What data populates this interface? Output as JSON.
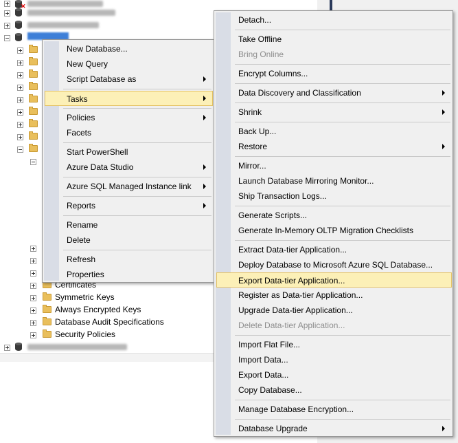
{
  "tree": {
    "visible_nodes": [
      "Certificates",
      "Symmetric Keys",
      "Always Encrypted Keys",
      "Database Audit Specifications",
      "Security Policies"
    ]
  },
  "database_menu": {
    "items": [
      "New Database...",
      "New Query",
      "Script Database as",
      "Tasks",
      "Policies",
      "Facets",
      "Start PowerShell",
      "Azure Data Studio",
      "Azure SQL Managed Instance link",
      "Reports",
      "Rename",
      "Delete",
      "Refresh",
      "Properties"
    ],
    "highlighted": "Tasks"
  },
  "tasks_menu": {
    "items": [
      "Detach...",
      "Take Offline",
      "Bring Online",
      "Encrypt Columns...",
      "Data Discovery and Classification",
      "Shrink",
      "Back Up...",
      "Restore",
      "Mirror...",
      "Launch Database Mirroring Monitor...",
      "Ship Transaction Logs...",
      "Generate Scripts...",
      "Generate In-Memory OLTP Migration Checklists",
      "Extract Data-tier Application...",
      "Deploy Database to Microsoft Azure SQL Database...",
      "Export Data-tier Application...",
      "Register as Data-tier Application...",
      "Upgrade Data-tier Application...",
      "Delete Data-tier Application...",
      "Import Flat File...",
      "Import Data...",
      "Export Data...",
      "Copy Database...",
      "Manage Database Encryption...",
      "Database Upgrade"
    ],
    "highlighted": "Export Data-tier Application...",
    "disabled": [
      "Bring Online",
      "Delete Data-tier Application..."
    ]
  },
  "colors": {
    "menu_background": "#f0f0f0",
    "menu_gutter": "#d9dde6",
    "highlight_fill": "#fcf0b7",
    "highlight_border": "#e5c365",
    "disabled_text": "#8d8d8d"
  }
}
